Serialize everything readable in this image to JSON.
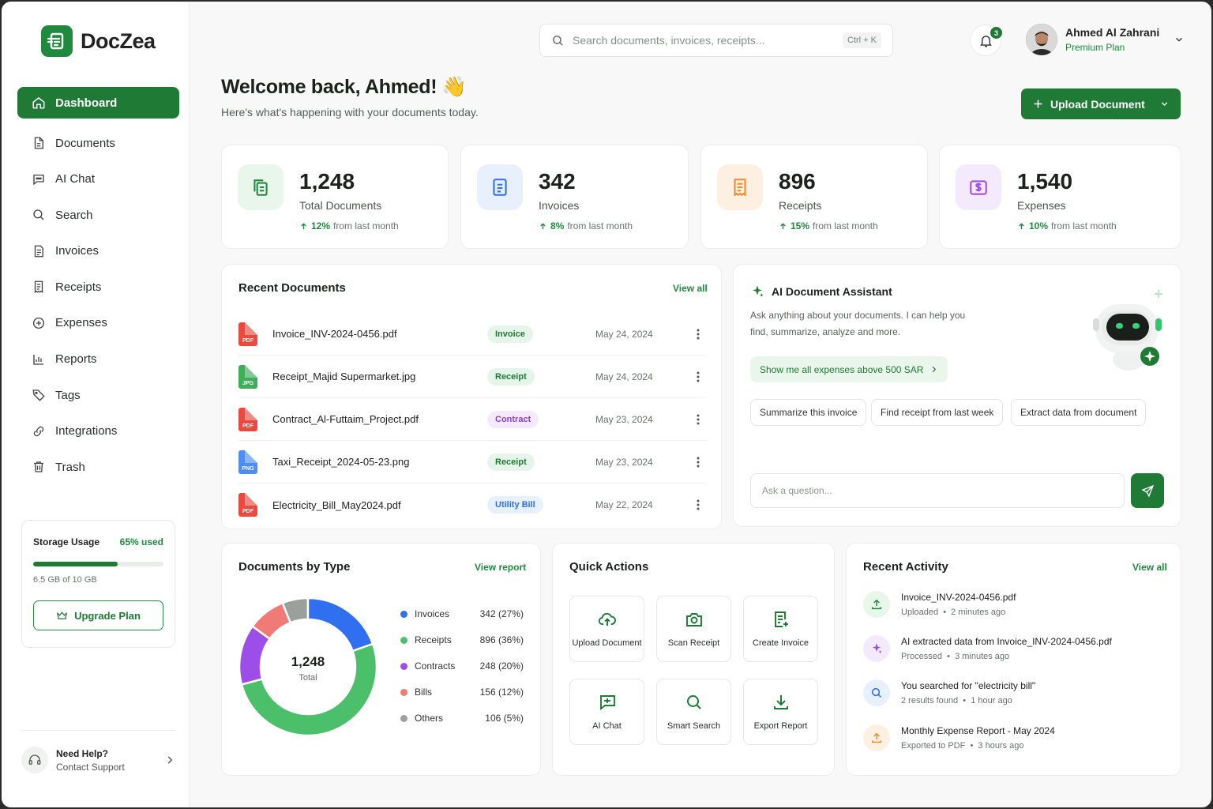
{
  "app": {
    "name": "DocZea"
  },
  "sidebar": {
    "items": [
      {
        "label": "Dashboard",
        "icon": "home-icon"
      },
      {
        "label": "Documents",
        "icon": "document-icon"
      },
      {
        "label": "AI Chat",
        "icon": "chat-icon"
      },
      {
        "label": "Search",
        "icon": "search-icon"
      },
      {
        "label": "Invoices",
        "icon": "invoice-icon"
      },
      {
        "label": "Receipts",
        "icon": "receipt-icon"
      },
      {
        "label": "Expenses",
        "icon": "expenses-icon"
      },
      {
        "label": "Reports",
        "icon": "reports-icon"
      },
      {
        "label": "Tags",
        "icon": "tag-icon"
      },
      {
        "label": "Integrations",
        "icon": "integrations-icon"
      },
      {
        "label": "Trash",
        "icon": "trash-icon"
      }
    ],
    "storage": {
      "title": "Storage Usage",
      "percent_label": "65% used",
      "used_fraction": 0.65,
      "detail": "6.5 GB of 10 GB",
      "upgrade_label": "Upgrade Plan"
    },
    "help": {
      "title": "Need Help?",
      "subtitle": "Contact Support"
    }
  },
  "header": {
    "search_placeholder": "Search documents, invoices, receipts...",
    "search_shortcut": "Ctrl + K",
    "notifications_count": "3",
    "user_name": "Ahmed Al Zahrani",
    "user_plan": "Premium Plan"
  },
  "welcome": {
    "title": "Welcome back, Ahmed! 👋",
    "subtitle": "Here's what's happening with your documents today.",
    "upload_label": "Upload Document"
  },
  "stats": [
    {
      "value": "1,248",
      "label": "Total Documents",
      "change": "12%",
      "change_suffix": "from last month"
    },
    {
      "value": "342",
      "label": "Invoices",
      "change": "8%",
      "change_suffix": "from last month"
    },
    {
      "value": "896",
      "label": "Receipts",
      "change": "15%",
      "change_suffix": "from last month"
    },
    {
      "value": "1,540",
      "label": "Expenses",
      "change": "10%",
      "change_suffix": "from last month"
    }
  ],
  "recent_documents": {
    "title": "Recent Documents",
    "view_all": "View all",
    "rows": [
      {
        "type": "PDF",
        "name": "Invoice_INV-2024-0456.pdf",
        "tag": "Invoice",
        "date": "May 24, 2024"
      },
      {
        "type": "JPG",
        "name": "Receipt_Majid Supermarket.jpg",
        "tag": "Receipt",
        "date": "May 24, 2024"
      },
      {
        "type": "PDF",
        "name": "Contract_Al-Futtaim_Project.pdf",
        "tag": "Contract",
        "date": "May 23, 2024"
      },
      {
        "type": "PNG",
        "name": "Taxi_Receipt_2024-05-23.png",
        "tag": "Receipt",
        "date": "May 23, 2024"
      },
      {
        "type": "PDF",
        "name": "Electricity_Bill_May2024.pdf",
        "tag": "Utility Bill",
        "date": "May 22, 2024"
      }
    ]
  },
  "ai_assistant": {
    "title": "AI Document Assistant",
    "description": "Ask anything about your documents. I can help you find, summarize, analyze and more.",
    "suggestion": "Show me all expenses above 500 SAR",
    "chips": [
      "Summarize this invoice",
      "Find receipt from last week",
      "Extract data from document"
    ],
    "input_placeholder": "Ask a question..."
  },
  "documents_by_type": {
    "title": "Documents by Type",
    "view_report": "View report",
    "center_value": "1,248",
    "center_label": "Total"
  },
  "chart_data": {
    "type": "pie",
    "categories": [
      "Invoices",
      "Receipts",
      "Contracts",
      "Bills",
      "Others"
    ],
    "values": [
      342,
      896,
      248,
      156,
      106
    ],
    "value_labels": [
      "342 (27%)",
      "896 (36%)",
      "248 (20%)",
      "156 (12%)",
      "106 (5%)"
    ],
    "percentages": [
      27,
      36,
      20,
      12,
      5
    ],
    "colors": [
      "#2f6ff0",
      "#4cbf6b",
      "#9d4ee8",
      "#f07a76",
      "#9aa19c"
    ],
    "donut": true
  },
  "quick_actions": {
    "title": "Quick Actions",
    "items": [
      {
        "label": "Upload Document",
        "icon": "cloud-upload-icon"
      },
      {
        "label": "Scan Receipt",
        "icon": "camera-icon"
      },
      {
        "label": "Create Invoice",
        "icon": "create-invoice-icon"
      },
      {
        "label": "AI Chat",
        "icon": "ai-chat-icon"
      },
      {
        "label": "Smart Search",
        "icon": "smart-search-icon"
      },
      {
        "label": "Export Report",
        "icon": "download-icon"
      }
    ]
  },
  "recent_activity": {
    "title": "Recent Activity",
    "view_all": "View all",
    "items": [
      {
        "title": "Invoice_INV-2024-0456.pdf",
        "action": "Uploaded",
        "time": "2 minutes ago",
        "icon": "upload-icon"
      },
      {
        "title": "AI extracted data from Invoice_INV-2024-0456.pdf",
        "action": "Processed",
        "time": "3 minutes ago",
        "icon": "sparkle-icon"
      },
      {
        "title": "You searched for \"electricity bill\"",
        "action": "2 results found",
        "time": "1 hour ago",
        "icon": "search-icon"
      },
      {
        "title": "Monthly Expense Report - May 2024",
        "action": "Exported to PDF",
        "time": "3 hours ago",
        "icon": "export-icon"
      }
    ]
  },
  "colors": {
    "brand": "#1f7a35",
    "accent_green": "#1f8a3e"
  }
}
